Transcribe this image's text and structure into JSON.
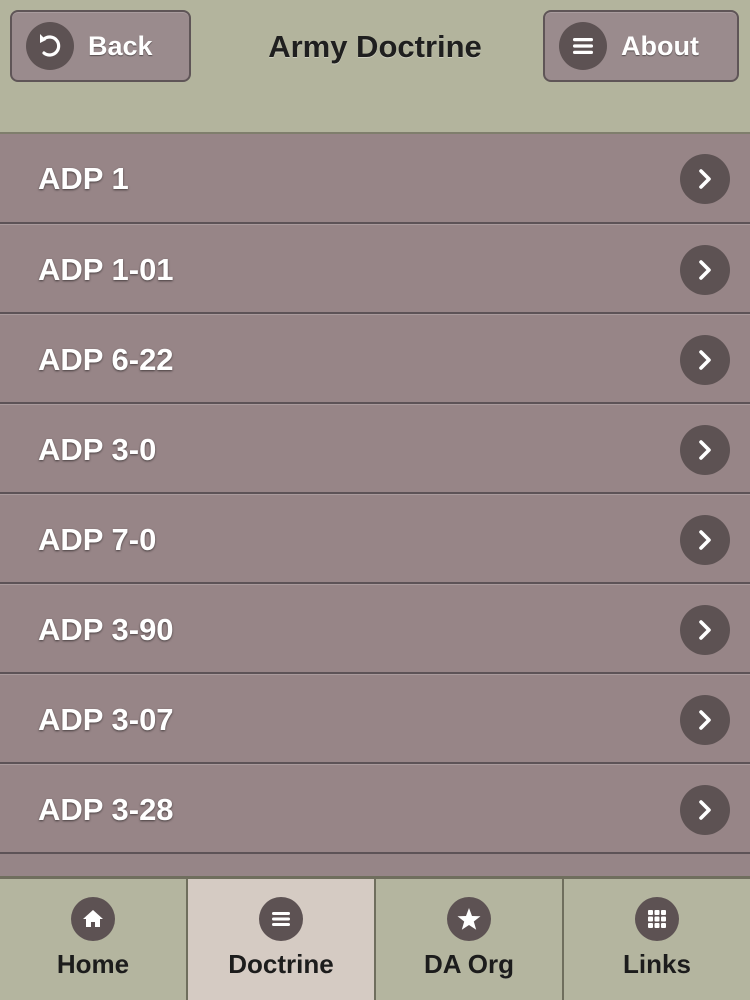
{
  "header": {
    "title": "Army Doctrine",
    "back_label": "Back",
    "about_label": "About"
  },
  "list": {
    "items": [
      {
        "label": "ADP 1"
      },
      {
        "label": "ADP 1-01"
      },
      {
        "label": "ADP 6-22"
      },
      {
        "label": "ADP 3-0"
      },
      {
        "label": "ADP 7-0"
      },
      {
        "label": "ADP 3-90"
      },
      {
        "label": "ADP 3-07"
      },
      {
        "label": "ADP 3-28"
      }
    ]
  },
  "tabbar": {
    "tabs": [
      {
        "label": "Home",
        "icon": "home-icon",
        "active": false
      },
      {
        "label": "Doctrine",
        "icon": "list-icon",
        "active": true
      },
      {
        "label": "DA Org",
        "icon": "star-icon",
        "active": false
      },
      {
        "label": "Links",
        "icon": "grid-icon",
        "active": false
      }
    ]
  },
  "colors": {
    "header_bg": "#b3b49d",
    "list_bg": "#968587",
    "icon_bg": "#5d5253",
    "active_tab_bg": "#d5cbc3"
  }
}
